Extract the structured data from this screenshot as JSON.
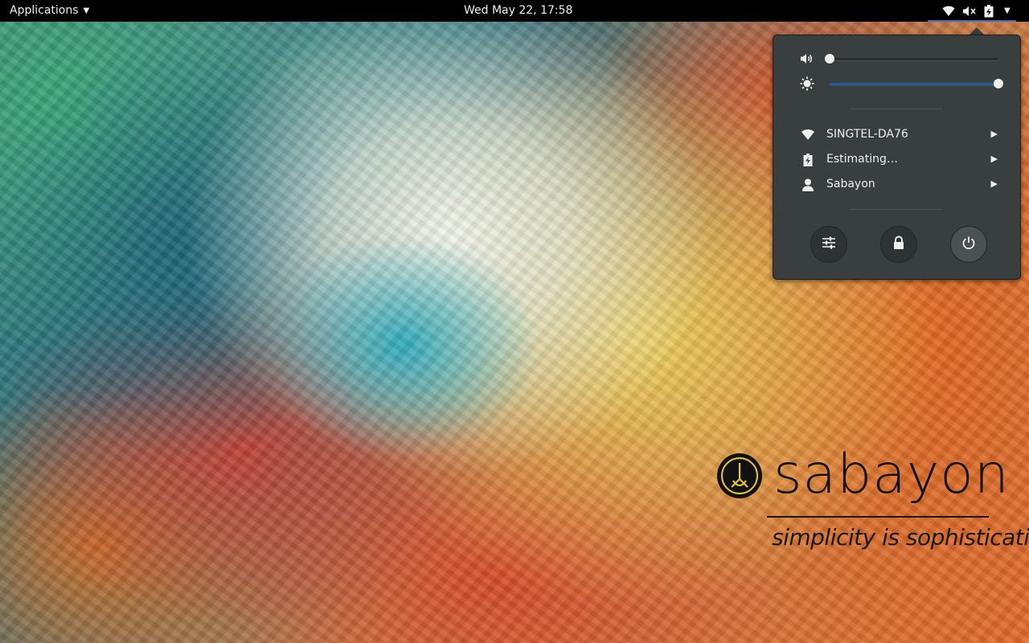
{
  "topbar": {
    "applications_label": "Applications",
    "clock": "Wed May 22, 17:58",
    "status_icons": [
      "wifi-icon",
      "volume-muted-icon",
      "battery-charging-icon",
      "chevron-down-icon"
    ]
  },
  "system_menu": {
    "volume": {
      "icon": "volume-icon",
      "level": 0.0
    },
    "brightness": {
      "icon": "brightness-icon",
      "level": 1.0
    },
    "items": [
      {
        "icon": "wifi-icon",
        "label": "SINGTEL-DA76"
      },
      {
        "icon": "battery-charging-icon",
        "label": "Estimating…"
      },
      {
        "icon": "user-icon",
        "label": "Sabayon"
      }
    ],
    "actions": [
      {
        "icon": "settings-sliders-icon",
        "name": "settings"
      },
      {
        "icon": "lock-icon",
        "name": "lock"
      },
      {
        "icon": "power-icon",
        "name": "power"
      }
    ]
  },
  "wallpaper": {
    "brand": "sabayon",
    "tagline": "simplicity is sophistication"
  },
  "colors": {
    "topbar_bg": "#000000",
    "menu_bg": "#393f3f",
    "accent": "#215d9c",
    "text": "#eeeeec"
  }
}
